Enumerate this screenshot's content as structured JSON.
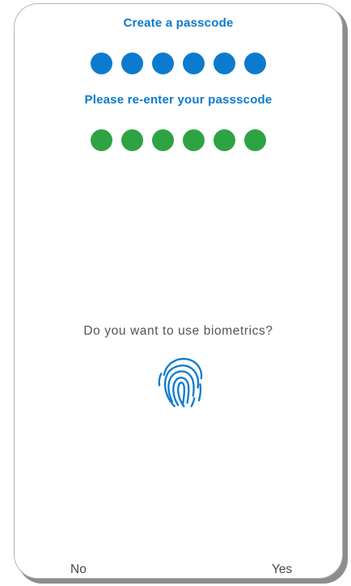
{
  "passcode": {
    "create_title": "Create a passcode",
    "reenter_title": "Please re-enter your passscode",
    "create_digits": 6,
    "confirm_digits": 6
  },
  "biometrics": {
    "question": "Do you want to use biometrics?",
    "icon": "fingerprint-icon"
  },
  "footer": {
    "no_label": "No",
    "yes_label": "Yes"
  },
  "colors": {
    "accent_blue": "#0c7bcf",
    "dot_blue": "#0c7bcf",
    "dot_green": "#2ea344",
    "text_gray": "#555555"
  }
}
